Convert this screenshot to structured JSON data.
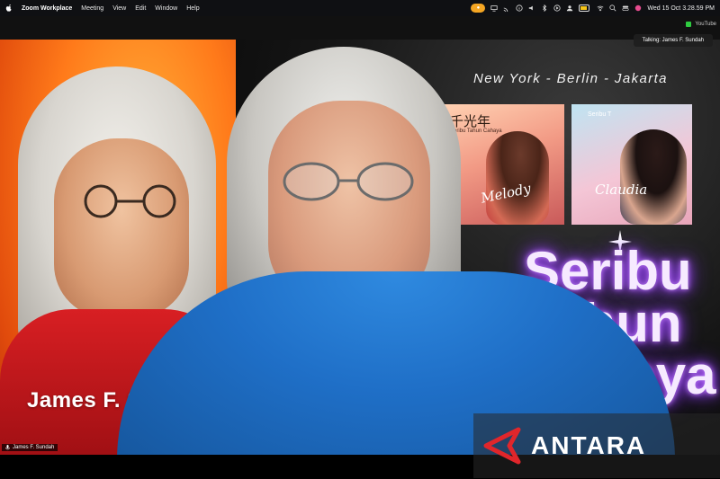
{
  "menubar": {
    "app_name": "Zoom Workplace",
    "menus": [
      "Meeting",
      "View",
      "Edit",
      "Window",
      "Help"
    ],
    "clock": "Wed 15 Oct  3.28.59 PM",
    "status_icons": [
      "zoom-mic-icon",
      "screen-mirror-icon",
      "cast-icon",
      "info-icon",
      "volume-icon",
      "bluetooth-icon",
      "play-icon",
      "user-icon",
      "battery-icon",
      "wifi-icon",
      "search-icon",
      "control-center-icon",
      "siri-icon"
    ]
  },
  "zoom": {
    "stream_label": "YouTube",
    "talking_label": "Talking: James F. Sundah",
    "participant_name": "James F. Sundah"
  },
  "video": {
    "left_poster_name": "James F. Su",
    "tagline": "New York - Berlin - Jakarta",
    "albums": [
      {
        "cjk": "千光年",
        "subtitle": "Seribu Tahun Cahaya",
        "script": "Melody"
      },
      {
        "subtitle": "Seribu T",
        "script": "Claudia"
      }
    ],
    "neon_lines": [
      "Seribu",
      "Tahun",
      "Cahaya"
    ]
  },
  "watermark": {
    "text": "ANTARA"
  },
  "colors": {
    "neon_glow": "#a34bff",
    "sweater": "#1f6fc7",
    "poster_orange": "#ff7a1a",
    "watermark_red": "#e0262b"
  }
}
